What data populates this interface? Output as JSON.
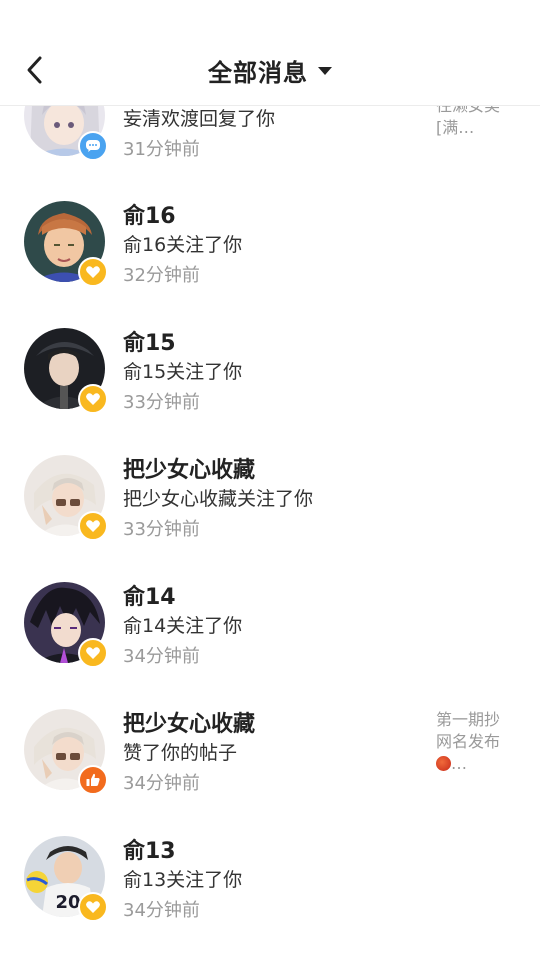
{
  "header": {
    "title": "全部消息"
  },
  "items": [
    {
      "name": "",
      "action": "妄清欢渡回复了你",
      "time": "31分钟前",
      "badge": "chat-icon",
      "snippet_l1": "往濑女美",
      "snippet_l2": "[满…",
      "snippet_l3": ""
    },
    {
      "name": "俞16",
      "action": "俞16关注了你",
      "time": "32分钟前",
      "badge": "heart-icon"
    },
    {
      "name": "俞15",
      "action": "俞15关注了你",
      "time": "33分钟前",
      "badge": "heart-icon"
    },
    {
      "name": "把少女心收藏",
      "action": "把少女心收藏关注了你",
      "time": "33分钟前",
      "badge": "heart-icon"
    },
    {
      "name": "俞14",
      "action": "俞14关注了你",
      "time": "34分钟前",
      "badge": "heart-icon"
    },
    {
      "name": "把少女心收藏",
      "action": "赞了你的帖子",
      "time": "34分钟前",
      "badge": "thumb-up-icon",
      "snippet_l1": "第一期抄",
      "snippet_l2": "网名发布",
      "snippet_l3": "…"
    },
    {
      "name": "俞13",
      "action": "俞13关注了你",
      "time": "34分钟前",
      "badge": "heart-icon"
    }
  ]
}
